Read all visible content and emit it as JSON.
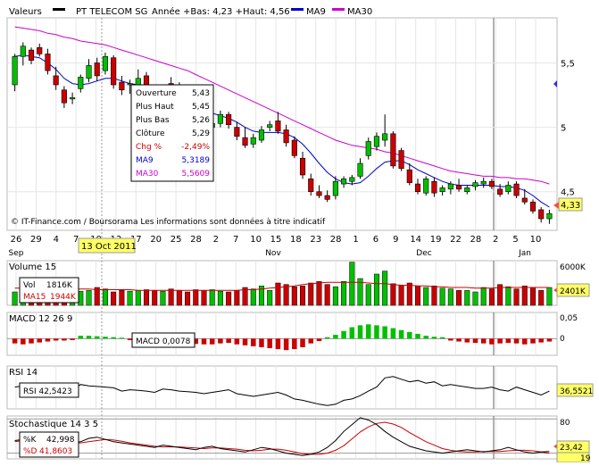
{
  "header": {
    "valeurs": "Valeurs",
    "instrument": "PT TELECOM SG",
    "range": "Année +Bas: 4,23 +Haut: 4,56",
    "ma9_label": "MA9",
    "ma30_label": "MA30"
  },
  "colors": {
    "background": "#ffffff",
    "grid": "#e6e6e6",
    "up": "#00c000",
    "down": "#cc0000",
    "ma9": "#0000cc",
    "ma30": "#cc00cc",
    "highlight_date_bg": "#ffff66",
    "last_price_bg": "#ffff66",
    "marker_bg": "#ff4444",
    "blue_arrow": "#3333cc",
    "vertical_marker": "#666666"
  },
  "footer_note": "© IT-Finance.com / Boursorama Les informations sont données à titre indicatif",
  "tooltip": {
    "rows": [
      {
        "label": "Ouverture",
        "value": "5,43",
        "color": "#000000"
      },
      {
        "label": "Plus Haut",
        "value": "5,45",
        "color": "#000000"
      },
      {
        "label": "Plus Bas",
        "value": "5,26",
        "color": "#000000"
      },
      {
        "label": "Clôture",
        "value": "5,29",
        "color": "#000000"
      },
      {
        "label": "Chg %",
        "value": "-2,49%",
        "color": "#cc0000"
      },
      {
        "label": "MA9",
        "value": "5,3189",
        "color": "#0000cc"
      },
      {
        "label": "MA30",
        "value": "5,5609",
        "color": "#cc00cc"
      }
    ]
  },
  "highlight_date": "13 Oct 2011",
  "last_price": "4,33",
  "panels": {
    "volume": {
      "title": "Volume 15",
      "vol_label": "Vol",
      "vol_value": "1816K",
      "ma_label": "MA15",
      "ma_value": "1944K",
      "axis_top": "6000K",
      "last_value": "2401K"
    },
    "macd": {
      "title": "MACD 12 26 9",
      "box_label": "MACD 0,0078",
      "axis_top": "0,05",
      "axis_zero": "0"
    },
    "rsi": {
      "title": "RSI 14",
      "box_label": "RSI 42,5423",
      "last_value": "36,5521"
    },
    "stoch": {
      "title": "Stochastique 14 3 5",
      "k_label": "%K",
      "k_value": "42,998",
      "d_label": "%D",
      "d_value": "41,8603",
      "axis_top": "80",
      "last_k": "23,42",
      "last_d": "19"
    }
  },
  "chart_data": {
    "type": "candlestick",
    "title": "PT TELECOM SG",
    "y_ticks": [
      4.5,
      5,
      5.5
    ],
    "y_tick_labels": [
      "4,5",
      "5",
      "5,5"
    ],
    "ylim": [
      4.2,
      5.85
    ],
    "x_tick_labels": [
      "26",
      "29",
      "4",
      "7",
      "10",
      "13",
      "17",
      "20",
      "25",
      "28",
      "2",
      "7",
      "10",
      "15",
      "18",
      "23",
      "28",
      "1",
      "6",
      "9",
      "14",
      "19",
      "22",
      "28",
      "2",
      "5",
      "10"
    ],
    "month_labels": [
      "Sep",
      "Nov",
      "Dec",
      "Jan"
    ],
    "candles": [
      [
        5.33,
        5.57,
        5.28,
        5.55
      ],
      [
        5.55,
        5.66,
        5.48,
        5.63
      ],
      [
        5.6,
        5.62,
        5.49,
        5.52
      ],
      [
        5.62,
        5.65,
        5.55,
        5.57
      ],
      [
        5.57,
        5.61,
        5.41,
        5.44
      ],
      [
        5.4,
        5.47,
        5.29,
        5.33
      ],
      [
        5.29,
        5.32,
        5.15,
        5.19
      ],
      [
        5.22,
        5.27,
        5.18,
        5.23
      ],
      [
        5.3,
        5.41,
        5.27,
        5.39
      ],
      [
        5.38,
        5.53,
        5.35,
        5.48
      ],
      [
        5.5,
        5.54,
        5.36,
        5.4
      ],
      [
        5.44,
        5.58,
        5.41,
        5.55
      ],
      [
        5.54,
        5.56,
        5.3,
        5.33
      ],
      [
        5.35,
        5.4,
        5.25,
        5.29
      ],
      [
        5.33,
        5.37,
        5.26,
        5.34
      ],
      [
        5.29,
        5.45,
        5.26,
        5.38
      ],
      [
        5.4,
        5.43,
        5.2,
        5.24
      ],
      [
        5.29,
        5.3,
        5.15,
        5.18
      ],
      [
        5.2,
        5.3,
        5.17,
        5.28
      ],
      [
        5.34,
        5.39,
        5.28,
        5.33
      ],
      [
        5.3,
        5.35,
        5.18,
        5.2
      ],
      [
        5.2,
        5.24,
        5.1,
        5.14
      ],
      [
        5.13,
        5.18,
        5.04,
        5.08
      ],
      [
        5.05,
        5.09,
        4.95,
        4.99
      ],
      [
        5.0,
        5.05,
        4.92,
        5.03
      ],
      [
        5.03,
        5.13,
        5.0,
        5.1
      ],
      [
        5.1,
        5.12,
        4.99,
        5.02
      ],
      [
        5.0,
        5.04,
        4.9,
        4.93
      ],
      [
        4.92,
        5.0,
        4.84,
        4.86
      ],
      [
        4.87,
        4.95,
        4.84,
        4.92
      ],
      [
        4.9,
        5.01,
        4.88,
        4.98
      ],
      [
        5.0,
        5.05,
        4.97,
        5.02
      ],
      [
        5.05,
        5.12,
        4.95,
        4.97
      ],
      [
        4.98,
        5.02,
        4.85,
        4.88
      ],
      [
        4.9,
        4.93,
        4.76,
        4.78
      ],
      [
        4.76,
        4.81,
        4.6,
        4.63
      ],
      [
        4.6,
        4.64,
        4.47,
        4.5
      ],
      [
        4.5,
        4.55,
        4.45,
        4.47
      ],
      [
        4.47,
        4.51,
        4.42,
        4.44
      ],
      [
        4.47,
        4.62,
        4.44,
        4.58
      ],
      [
        4.56,
        4.62,
        4.53,
        4.6
      ],
      [
        4.58,
        4.63,
        4.55,
        4.61
      ],
      [
        4.62,
        4.76,
        4.6,
        4.72
      ],
      [
        4.78,
        4.92,
        4.75,
        4.89
      ],
      [
        4.85,
        4.96,
        4.82,
        4.93
      ],
      [
        4.9,
        5.1,
        4.85,
        4.95
      ],
      [
        4.95,
        4.97,
        4.68,
        4.7
      ],
      [
        4.82,
        4.84,
        4.66,
        4.68
      ],
      [
        4.67,
        4.72,
        4.55,
        4.57
      ],
      [
        4.56,
        4.6,
        4.48,
        4.5
      ],
      [
        4.49,
        4.62,
        4.47,
        4.6
      ],
      [
        4.58,
        4.61,
        4.46,
        4.49
      ],
      [
        4.5,
        4.55,
        4.47,
        4.53
      ],
      [
        4.52,
        4.58,
        4.48,
        4.56
      ],
      [
        4.55,
        4.6,
        4.5,
        4.52
      ],
      [
        4.5,
        4.55,
        4.48,
        4.53
      ],
      [
        4.54,
        4.59,
        4.51,
        4.57
      ],
      [
        4.56,
        4.61,
        4.53,
        4.58
      ],
      [
        4.58,
        4.6,
        4.52,
        4.54
      ],
      [
        4.52,
        4.56,
        4.46,
        4.48
      ],
      [
        4.5,
        4.58,
        4.48,
        4.55
      ],
      [
        4.56,
        4.58,
        4.45,
        4.47
      ],
      [
        4.45,
        4.52,
        4.4,
        4.42
      ],
      [
        4.42,
        4.44,
        4.33,
        4.35
      ],
      [
        4.36,
        4.38,
        4.26,
        4.29
      ],
      [
        4.29,
        4.36,
        4.25,
        4.33
      ]
    ],
    "ma9": [
      5.55,
      5.56,
      5.55,
      5.54,
      5.5,
      5.45,
      5.38,
      5.34,
      5.33,
      5.34,
      5.36,
      5.38,
      5.38,
      5.36,
      5.34,
      5.33,
      5.31,
      5.28,
      5.26,
      5.25,
      5.24,
      5.22,
      5.19,
      5.15,
      5.11,
      5.09,
      5.07,
      5.04,
      5.0,
      4.97,
      4.96,
      4.96,
      4.96,
      4.95,
      4.92,
      4.87,
      4.8,
      4.72,
      4.65,
      4.6,
      4.57,
      4.56,
      4.57,
      4.62,
      4.68,
      4.73,
      4.74,
      4.74,
      4.71,
      4.67,
      4.64,
      4.61,
      4.58,
      4.56,
      4.55,
      4.55,
      4.55,
      4.55,
      4.55,
      4.54,
      4.54,
      4.53,
      4.51,
      4.47,
      4.42,
      4.38
    ],
    "ma30": [
      5.78,
      5.77,
      5.76,
      5.75,
      5.73,
      5.72,
      5.7,
      5.69,
      5.67,
      5.66,
      5.65,
      5.64,
      5.62,
      5.6,
      5.58,
      5.56,
      5.54,
      5.52,
      5.5,
      5.48,
      5.46,
      5.44,
      5.41,
      5.38,
      5.35,
      5.32,
      5.29,
      5.26,
      5.23,
      5.2,
      5.17,
      5.14,
      5.11,
      5.08,
      5.05,
      5.02,
      4.99,
      4.96,
      4.93,
      4.9,
      4.88,
      4.86,
      4.85,
      4.84,
      4.83,
      4.81,
      4.8,
      4.78,
      4.76,
      4.74,
      4.72,
      4.7,
      4.68,
      4.66,
      4.65,
      4.64,
      4.63,
      4.62,
      4.62,
      4.61,
      4.61,
      4.6,
      4.6,
      4.59,
      4.58,
      4.56
    ],
    "volume": [
      1.8,
      2.2,
      2.0,
      1.9,
      2.3,
      2.5,
      2.6,
      2.1,
      1.9,
      2.0,
      2.4,
      2.2,
      1.8,
      2.0,
      1.9,
      2.0,
      2.1,
      2.0,
      1.9,
      2.2,
      2.0,
      1.8,
      2.1,
      2.0,
      2.1,
      1.9,
      1.8,
      2.0,
      2.4,
      2.2,
      2.6,
      2.0,
      3.0,
      2.8,
      2.5,
      2.6,
      3.0,
      3.2,
      2.8,
      2.5,
      3.2,
      5.8,
      3.6,
      2.8,
      4.2,
      4.6,
      2.9,
      2.7,
      3.0,
      2.6,
      2.4,
      2.6,
      2.3,
      2.2,
      2.0,
      2.0,
      1.8,
      2.4,
      2.2,
      2.8,
      2.5,
      2.2,
      2.6,
      2.4,
      2.0,
      2.4
    ],
    "volume_ma15": [
      2.3,
      2.3,
      2.2,
      2.2,
      2.2,
      2.2,
      2.1,
      2.2,
      2.2,
      2.2,
      2.1,
      2.1,
      2.1,
      2.1,
      2.1,
      2.0,
      2.0,
      2.0,
      2.0,
      2.0,
      2.0,
      2.0,
      2.0,
      2.0,
      2.0,
      2.0,
      2.0,
      2.0,
      2.1,
      2.1,
      2.2,
      2.3,
      2.4,
      2.5,
      2.6,
      2.8,
      2.9,
      3.0,
      3.1,
      3.1,
      3.1,
      3.1,
      3.1,
      3.0,
      2.9,
      2.9,
      2.8,
      2.7,
      2.7,
      2.6,
      2.6,
      2.5,
      2.5,
      2.4,
      2.4,
      2.4,
      2.3,
      2.3,
      2.3,
      2.4,
      2.4,
      2.4,
      2.4,
      2.4,
      2.4,
      2.4
    ],
    "volume_ylim": [
      0,
      6
    ],
    "macd_hist": [
      -0.01,
      -0.012,
      -0.01,
      -0.008,
      -0.006,
      -0.004,
      -0.004,
      -0.003,
      0.006,
      0.006,
      0.005,
      0.004,
      0.003,
      0.002,
      -0.003,
      -0.004,
      -0.005,
      -0.006,
      -0.007,
      -0.008,
      -0.009,
      -0.01,
      -0.011,
      -0.012,
      -0.012,
      -0.01,
      -0.009,
      -0.012,
      -0.014,
      -0.016,
      -0.018,
      -0.02,
      -0.022,
      -0.024,
      -0.022,
      -0.018,
      -0.01,
      -0.005,
      0.003,
      0.008,
      0.016,
      0.024,
      0.028,
      0.03,
      0.028,
      0.026,
      0.022,
      0.018,
      0.014,
      0.01,
      0.006,
      0.004,
      0.003,
      -0.004,
      -0.006,
      -0.008,
      -0.009,
      -0.01,
      -0.012,
      -0.01,
      -0.009,
      -0.01,
      -0.012,
      -0.01,
      -0.008,
      -0.006
    ],
    "macd_ylim": [
      -0.035,
      0.055
    ],
    "rsi": [
      48,
      50,
      52,
      51,
      50,
      46,
      44,
      43,
      52,
      50,
      49,
      48,
      47,
      42,
      44,
      43,
      42,
      40,
      45,
      44,
      42,
      41,
      40,
      38,
      40,
      42,
      44,
      38,
      36,
      34,
      36,
      38,
      40,
      36,
      30,
      28,
      25,
      22,
      20,
      22,
      28,
      30,
      35,
      42,
      48,
      62,
      64,
      60,
      56,
      58,
      54,
      56,
      50,
      52,
      50,
      48,
      46,
      46,
      48,
      44,
      42,
      48,
      44,
      40,
      36,
      42
    ],
    "rsi_ylim": [
      15,
      80
    ],
    "stoch_k": [
      42,
      44,
      46,
      48,
      44,
      40,
      36,
      38,
      40,
      46,
      48,
      44,
      40,
      38,
      36,
      34,
      32,
      30,
      34,
      32,
      30,
      28,
      26,
      30,
      32,
      28,
      26,
      24,
      22,
      26,
      30,
      28,
      24,
      20,
      18,
      16,
      18,
      22,
      30,
      42,
      58,
      70,
      82,
      78,
      70,
      58,
      48,
      40,
      32,
      28,
      24,
      22,
      20,
      22,
      24,
      26,
      24,
      22,
      24,
      26,
      30,
      26,
      22,
      20,
      22,
      23
    ],
    "stoch_d": [
      40,
      42,
      43,
      44,
      44,
      42,
      40,
      38,
      38,
      40,
      42,
      44,
      43,
      41,
      38,
      36,
      34,
      32,
      31,
      31,
      31,
      30,
      29,
      28,
      29,
      29,
      28,
      27,
      25,
      24,
      25,
      27,
      27,
      25,
      22,
      19,
      18,
      18,
      20,
      25,
      33,
      45,
      57,
      66,
      72,
      74,
      71,
      65,
      56,
      48,
      40,
      34,
      28,
      25,
      23,
      22,
      22,
      23,
      23,
      23,
      24,
      25,
      25,
      24,
      22,
      20
    ],
    "stoch_ylim": [
      10,
      85
    ]
  }
}
